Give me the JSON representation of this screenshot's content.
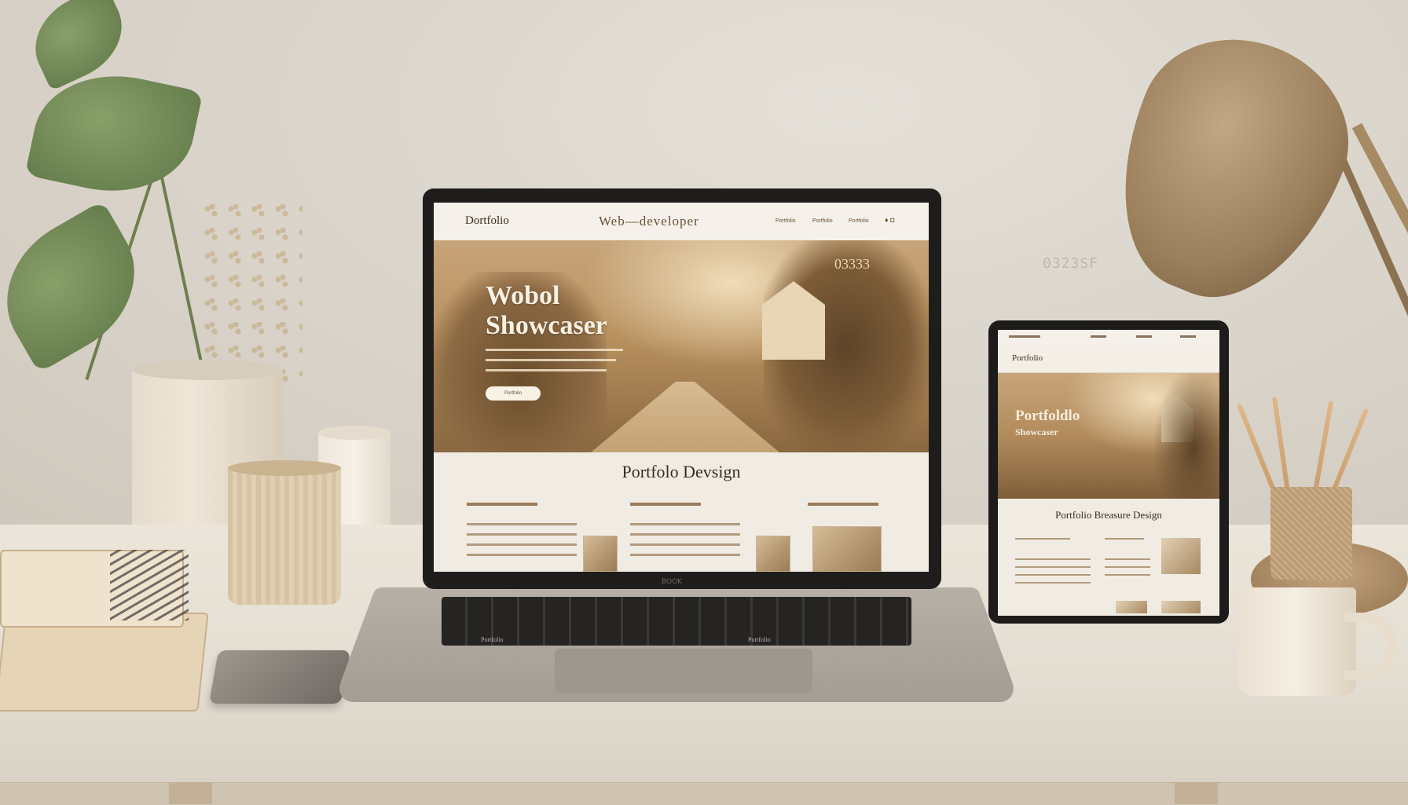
{
  "scene": {
    "wall_number": "0323SF"
  },
  "laptop": {
    "brand": "BOOK",
    "site": {
      "logo": "Dortfolio",
      "nav_title": "Web—developer",
      "nav_links": [
        "Portfolio",
        "Portfolio",
        "Portfolio"
      ],
      "hero_number": "03333",
      "hero_title_line1": "Wobol",
      "hero_title_line2": "Showcaser",
      "hero_button": "Portfolio",
      "section_title": "Portfolo Devsign",
      "keyboard_label_left": "Portfolio",
      "keyboard_label_right": "Portfolio"
    }
  },
  "tablet": {
    "site": {
      "logo": "Portfolio",
      "hero_title_line1": "Portfoldlo",
      "hero_title_line2": "Showcaser",
      "section_title": "Portfolio Breasure Design"
    }
  }
}
